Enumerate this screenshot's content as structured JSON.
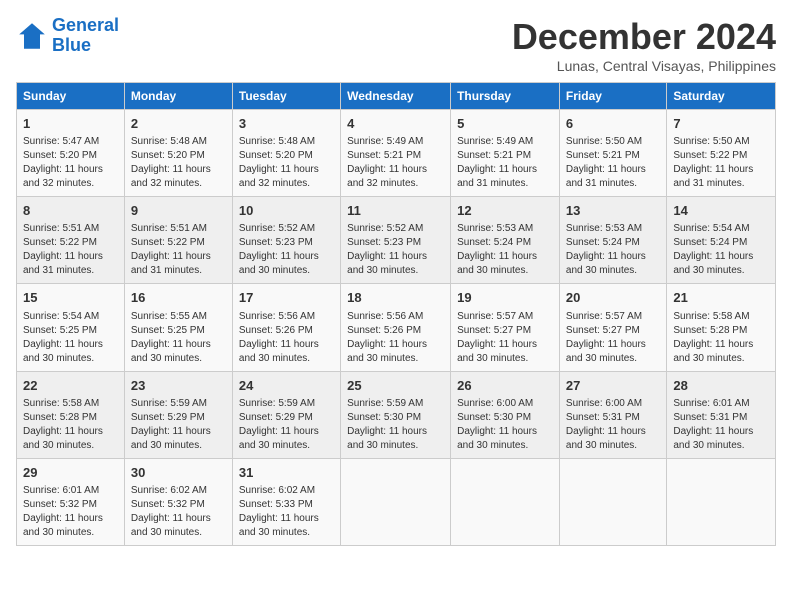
{
  "logo": {
    "line1": "General",
    "line2": "Blue"
  },
  "title": "December 2024",
  "location": "Lunas, Central Visayas, Philippines",
  "days_of_week": [
    "Sunday",
    "Monday",
    "Tuesday",
    "Wednesday",
    "Thursday",
    "Friday",
    "Saturday"
  ],
  "weeks": [
    [
      {
        "day": 1,
        "info": "Sunrise: 5:47 AM\nSunset: 5:20 PM\nDaylight: 11 hours\nand 32 minutes."
      },
      {
        "day": 2,
        "info": "Sunrise: 5:48 AM\nSunset: 5:20 PM\nDaylight: 11 hours\nand 32 minutes."
      },
      {
        "day": 3,
        "info": "Sunrise: 5:48 AM\nSunset: 5:20 PM\nDaylight: 11 hours\nand 32 minutes."
      },
      {
        "day": 4,
        "info": "Sunrise: 5:49 AM\nSunset: 5:21 PM\nDaylight: 11 hours\nand 32 minutes."
      },
      {
        "day": 5,
        "info": "Sunrise: 5:49 AM\nSunset: 5:21 PM\nDaylight: 11 hours\nand 31 minutes."
      },
      {
        "day": 6,
        "info": "Sunrise: 5:50 AM\nSunset: 5:21 PM\nDaylight: 11 hours\nand 31 minutes."
      },
      {
        "day": 7,
        "info": "Sunrise: 5:50 AM\nSunset: 5:22 PM\nDaylight: 11 hours\nand 31 minutes."
      }
    ],
    [
      {
        "day": 8,
        "info": "Sunrise: 5:51 AM\nSunset: 5:22 PM\nDaylight: 11 hours\nand 31 minutes."
      },
      {
        "day": 9,
        "info": "Sunrise: 5:51 AM\nSunset: 5:22 PM\nDaylight: 11 hours\nand 31 minutes."
      },
      {
        "day": 10,
        "info": "Sunrise: 5:52 AM\nSunset: 5:23 PM\nDaylight: 11 hours\nand 30 minutes."
      },
      {
        "day": 11,
        "info": "Sunrise: 5:52 AM\nSunset: 5:23 PM\nDaylight: 11 hours\nand 30 minutes."
      },
      {
        "day": 12,
        "info": "Sunrise: 5:53 AM\nSunset: 5:24 PM\nDaylight: 11 hours\nand 30 minutes."
      },
      {
        "day": 13,
        "info": "Sunrise: 5:53 AM\nSunset: 5:24 PM\nDaylight: 11 hours\nand 30 minutes."
      },
      {
        "day": 14,
        "info": "Sunrise: 5:54 AM\nSunset: 5:24 PM\nDaylight: 11 hours\nand 30 minutes."
      }
    ],
    [
      {
        "day": 15,
        "info": "Sunrise: 5:54 AM\nSunset: 5:25 PM\nDaylight: 11 hours\nand 30 minutes."
      },
      {
        "day": 16,
        "info": "Sunrise: 5:55 AM\nSunset: 5:25 PM\nDaylight: 11 hours\nand 30 minutes."
      },
      {
        "day": 17,
        "info": "Sunrise: 5:56 AM\nSunset: 5:26 PM\nDaylight: 11 hours\nand 30 minutes."
      },
      {
        "day": 18,
        "info": "Sunrise: 5:56 AM\nSunset: 5:26 PM\nDaylight: 11 hours\nand 30 minutes."
      },
      {
        "day": 19,
        "info": "Sunrise: 5:57 AM\nSunset: 5:27 PM\nDaylight: 11 hours\nand 30 minutes."
      },
      {
        "day": 20,
        "info": "Sunrise: 5:57 AM\nSunset: 5:27 PM\nDaylight: 11 hours\nand 30 minutes."
      },
      {
        "day": 21,
        "info": "Sunrise: 5:58 AM\nSunset: 5:28 PM\nDaylight: 11 hours\nand 30 minutes."
      }
    ],
    [
      {
        "day": 22,
        "info": "Sunrise: 5:58 AM\nSunset: 5:28 PM\nDaylight: 11 hours\nand 30 minutes."
      },
      {
        "day": 23,
        "info": "Sunrise: 5:59 AM\nSunset: 5:29 PM\nDaylight: 11 hours\nand 30 minutes."
      },
      {
        "day": 24,
        "info": "Sunrise: 5:59 AM\nSunset: 5:29 PM\nDaylight: 11 hours\nand 30 minutes."
      },
      {
        "day": 25,
        "info": "Sunrise: 5:59 AM\nSunset: 5:30 PM\nDaylight: 11 hours\nand 30 minutes."
      },
      {
        "day": 26,
        "info": "Sunrise: 6:00 AM\nSunset: 5:30 PM\nDaylight: 11 hours\nand 30 minutes."
      },
      {
        "day": 27,
        "info": "Sunrise: 6:00 AM\nSunset: 5:31 PM\nDaylight: 11 hours\nand 30 minutes."
      },
      {
        "day": 28,
        "info": "Sunrise: 6:01 AM\nSunset: 5:31 PM\nDaylight: 11 hours\nand 30 minutes."
      }
    ],
    [
      {
        "day": 29,
        "info": "Sunrise: 6:01 AM\nSunset: 5:32 PM\nDaylight: 11 hours\nand 30 minutes."
      },
      {
        "day": 30,
        "info": "Sunrise: 6:02 AM\nSunset: 5:32 PM\nDaylight: 11 hours\nand 30 minutes."
      },
      {
        "day": 31,
        "info": "Sunrise: 6:02 AM\nSunset: 5:33 PM\nDaylight: 11 hours\nand 30 minutes."
      },
      null,
      null,
      null,
      null
    ]
  ]
}
